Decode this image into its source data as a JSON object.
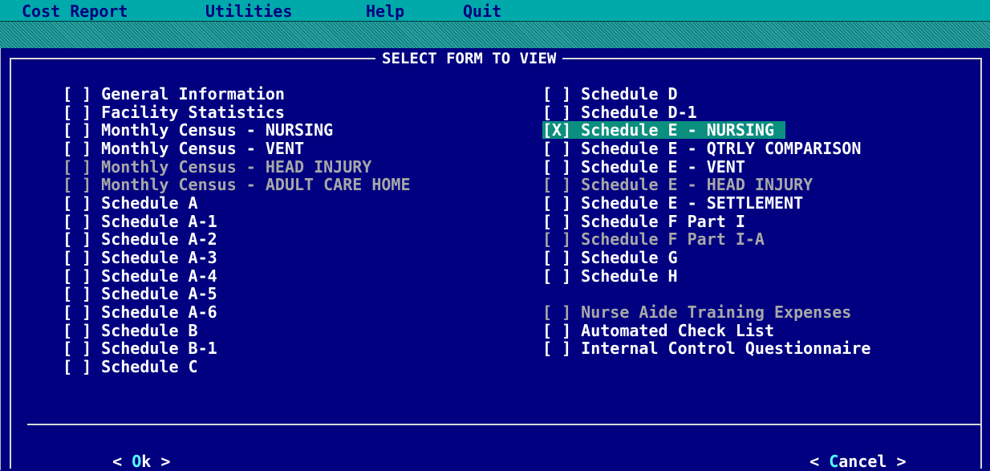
{
  "menubar": {
    "items": [
      "Cost Report",
      "Utilities",
      "Help",
      "Quit"
    ]
  },
  "dialog": {
    "title": "SELECT FORM TO VIEW",
    "left_column": [
      {
        "check": "[ ]",
        "label": "General Information"
      },
      {
        "check": "[ ]",
        "label": "Facility Statistics"
      },
      {
        "check": "[ ]",
        "label": "Monthly Census - NURSING"
      },
      {
        "check": "[ ]",
        "label": "Monthly Census - VENT"
      },
      {
        "check": "[ ]",
        "label": "Monthly Census - HEAD INJURY",
        "disabled": true
      },
      {
        "check": "[ ]",
        "label": "Monthly Census - ADULT CARE HOME",
        "disabled": true
      },
      {
        "check": "[ ]",
        "label": "Schedule A"
      },
      {
        "check": "[ ]",
        "label": "Schedule A-1"
      },
      {
        "check": "[ ]",
        "label": "Schedule A-2"
      },
      {
        "check": "[ ]",
        "label": "Schedule A-3"
      },
      {
        "check": "[ ]",
        "label": "Schedule A-4"
      },
      {
        "check": "[ ]",
        "label": "Schedule A-5"
      },
      {
        "check": "[ ]",
        "label": "Schedule A-6"
      },
      {
        "check": "[ ]",
        "label": "Schedule B"
      },
      {
        "check": "[ ]",
        "label": "Schedule B-1"
      },
      {
        "check": "[ ]",
        "label": "Schedule C"
      }
    ],
    "right_column": [
      {
        "check": "[ ]",
        "label": "Schedule D"
      },
      {
        "check": "[ ]",
        "label": "Schedule D-1"
      },
      {
        "check": "[X]",
        "label": "Schedule E - NURSING",
        "selected": true
      },
      {
        "check": "[ ]",
        "label": "Schedule E - QTRLY COMPARISON"
      },
      {
        "check": "[ ]",
        "label": "Schedule E - VENT"
      },
      {
        "check": "[ ]",
        "label": "Schedule E - HEAD INJURY",
        "disabled": true
      },
      {
        "check": "[ ]",
        "label": "Schedule E - SETTLEMENT"
      },
      {
        "check": "[ ]",
        "label": "Schedule F Part I"
      },
      {
        "check": "[ ]",
        "label": "Schedule F Part I-A",
        "disabled": true
      },
      {
        "check": "[ ]",
        "label": "Schedule G"
      },
      {
        "check": "[ ]",
        "label": "Schedule H"
      }
    ],
    "right_column_extra": [
      {
        "check": "[ ]",
        "label": "Nurse Aide Training Expenses",
        "disabled": true
      },
      {
        "check": "[ ]",
        "label": "Automated Check List"
      },
      {
        "check": "[ ]",
        "label": "Internal Control Questionnaire"
      }
    ],
    "buttons": {
      "ok": {
        "open": "< ",
        "hotkey": "O",
        "rest": "k",
        "close": " >"
      },
      "cancel": {
        "open": "< ",
        "hotkey": "C",
        "rest": "ancel",
        "close": " >"
      }
    }
  },
  "colors": {
    "background": "#000080",
    "menubar": "#00aaaa",
    "selection": "#0b8f7f",
    "disabled_text": "#a8a8a8",
    "hotkey": "#55ffff"
  }
}
